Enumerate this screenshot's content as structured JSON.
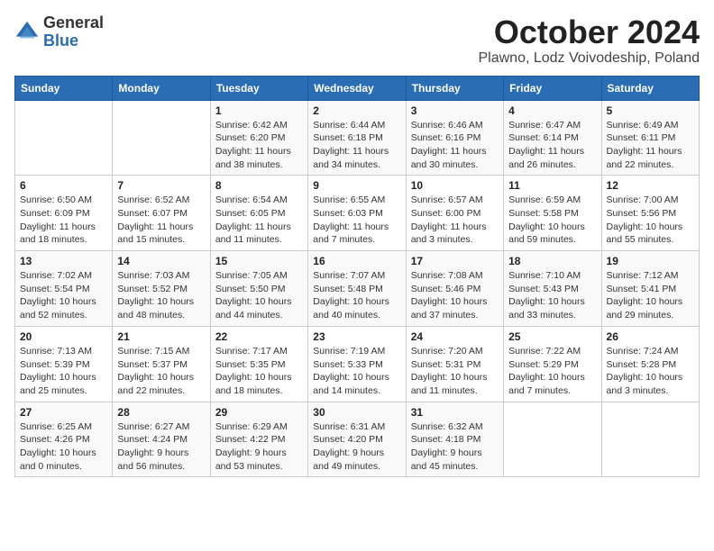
{
  "logo": {
    "general": "General",
    "blue": "Blue"
  },
  "title": "October 2024",
  "location": "Plawno, Lodz Voivodeship, Poland",
  "days_of_week": [
    "Sunday",
    "Monday",
    "Tuesday",
    "Wednesday",
    "Thursday",
    "Friday",
    "Saturday"
  ],
  "weeks": [
    [
      {
        "day": "",
        "info": ""
      },
      {
        "day": "",
        "info": ""
      },
      {
        "day": "1",
        "info": "Sunrise: 6:42 AM\nSunset: 6:20 PM\nDaylight: 11 hours\nand 38 minutes."
      },
      {
        "day": "2",
        "info": "Sunrise: 6:44 AM\nSunset: 6:18 PM\nDaylight: 11 hours\nand 34 minutes."
      },
      {
        "day": "3",
        "info": "Sunrise: 6:46 AM\nSunset: 6:16 PM\nDaylight: 11 hours\nand 30 minutes."
      },
      {
        "day": "4",
        "info": "Sunrise: 6:47 AM\nSunset: 6:14 PM\nDaylight: 11 hours\nand 26 minutes."
      },
      {
        "day": "5",
        "info": "Sunrise: 6:49 AM\nSunset: 6:11 PM\nDaylight: 11 hours\nand 22 minutes."
      }
    ],
    [
      {
        "day": "6",
        "info": "Sunrise: 6:50 AM\nSunset: 6:09 PM\nDaylight: 11 hours\nand 18 minutes."
      },
      {
        "day": "7",
        "info": "Sunrise: 6:52 AM\nSunset: 6:07 PM\nDaylight: 11 hours\nand 15 minutes."
      },
      {
        "day": "8",
        "info": "Sunrise: 6:54 AM\nSunset: 6:05 PM\nDaylight: 11 hours\nand 11 minutes."
      },
      {
        "day": "9",
        "info": "Sunrise: 6:55 AM\nSunset: 6:03 PM\nDaylight: 11 hours\nand 7 minutes."
      },
      {
        "day": "10",
        "info": "Sunrise: 6:57 AM\nSunset: 6:00 PM\nDaylight: 11 hours\nand 3 minutes."
      },
      {
        "day": "11",
        "info": "Sunrise: 6:59 AM\nSunset: 5:58 PM\nDaylight: 10 hours\nand 59 minutes."
      },
      {
        "day": "12",
        "info": "Sunrise: 7:00 AM\nSunset: 5:56 PM\nDaylight: 10 hours\nand 55 minutes."
      }
    ],
    [
      {
        "day": "13",
        "info": "Sunrise: 7:02 AM\nSunset: 5:54 PM\nDaylight: 10 hours\nand 52 minutes."
      },
      {
        "day": "14",
        "info": "Sunrise: 7:03 AM\nSunset: 5:52 PM\nDaylight: 10 hours\nand 48 minutes."
      },
      {
        "day": "15",
        "info": "Sunrise: 7:05 AM\nSunset: 5:50 PM\nDaylight: 10 hours\nand 44 minutes."
      },
      {
        "day": "16",
        "info": "Sunrise: 7:07 AM\nSunset: 5:48 PM\nDaylight: 10 hours\nand 40 minutes."
      },
      {
        "day": "17",
        "info": "Sunrise: 7:08 AM\nSunset: 5:46 PM\nDaylight: 10 hours\nand 37 minutes."
      },
      {
        "day": "18",
        "info": "Sunrise: 7:10 AM\nSunset: 5:43 PM\nDaylight: 10 hours\nand 33 minutes."
      },
      {
        "day": "19",
        "info": "Sunrise: 7:12 AM\nSunset: 5:41 PM\nDaylight: 10 hours\nand 29 minutes."
      }
    ],
    [
      {
        "day": "20",
        "info": "Sunrise: 7:13 AM\nSunset: 5:39 PM\nDaylight: 10 hours\nand 25 minutes."
      },
      {
        "day": "21",
        "info": "Sunrise: 7:15 AM\nSunset: 5:37 PM\nDaylight: 10 hours\nand 22 minutes."
      },
      {
        "day": "22",
        "info": "Sunrise: 7:17 AM\nSunset: 5:35 PM\nDaylight: 10 hours\nand 18 minutes."
      },
      {
        "day": "23",
        "info": "Sunrise: 7:19 AM\nSunset: 5:33 PM\nDaylight: 10 hours\nand 14 minutes."
      },
      {
        "day": "24",
        "info": "Sunrise: 7:20 AM\nSunset: 5:31 PM\nDaylight: 10 hours\nand 11 minutes."
      },
      {
        "day": "25",
        "info": "Sunrise: 7:22 AM\nSunset: 5:29 PM\nDaylight: 10 hours\nand 7 minutes."
      },
      {
        "day": "26",
        "info": "Sunrise: 7:24 AM\nSunset: 5:28 PM\nDaylight: 10 hours\nand 3 minutes."
      }
    ],
    [
      {
        "day": "27",
        "info": "Sunrise: 6:25 AM\nSunset: 4:26 PM\nDaylight: 10 hours\nand 0 minutes."
      },
      {
        "day": "28",
        "info": "Sunrise: 6:27 AM\nSunset: 4:24 PM\nDaylight: 9 hours\nand 56 minutes."
      },
      {
        "day": "29",
        "info": "Sunrise: 6:29 AM\nSunset: 4:22 PM\nDaylight: 9 hours\nand 53 minutes."
      },
      {
        "day": "30",
        "info": "Sunrise: 6:31 AM\nSunset: 4:20 PM\nDaylight: 9 hours\nand 49 minutes."
      },
      {
        "day": "31",
        "info": "Sunrise: 6:32 AM\nSunset: 4:18 PM\nDaylight: 9 hours\nand 45 minutes."
      },
      {
        "day": "",
        "info": ""
      },
      {
        "day": "",
        "info": ""
      }
    ]
  ]
}
